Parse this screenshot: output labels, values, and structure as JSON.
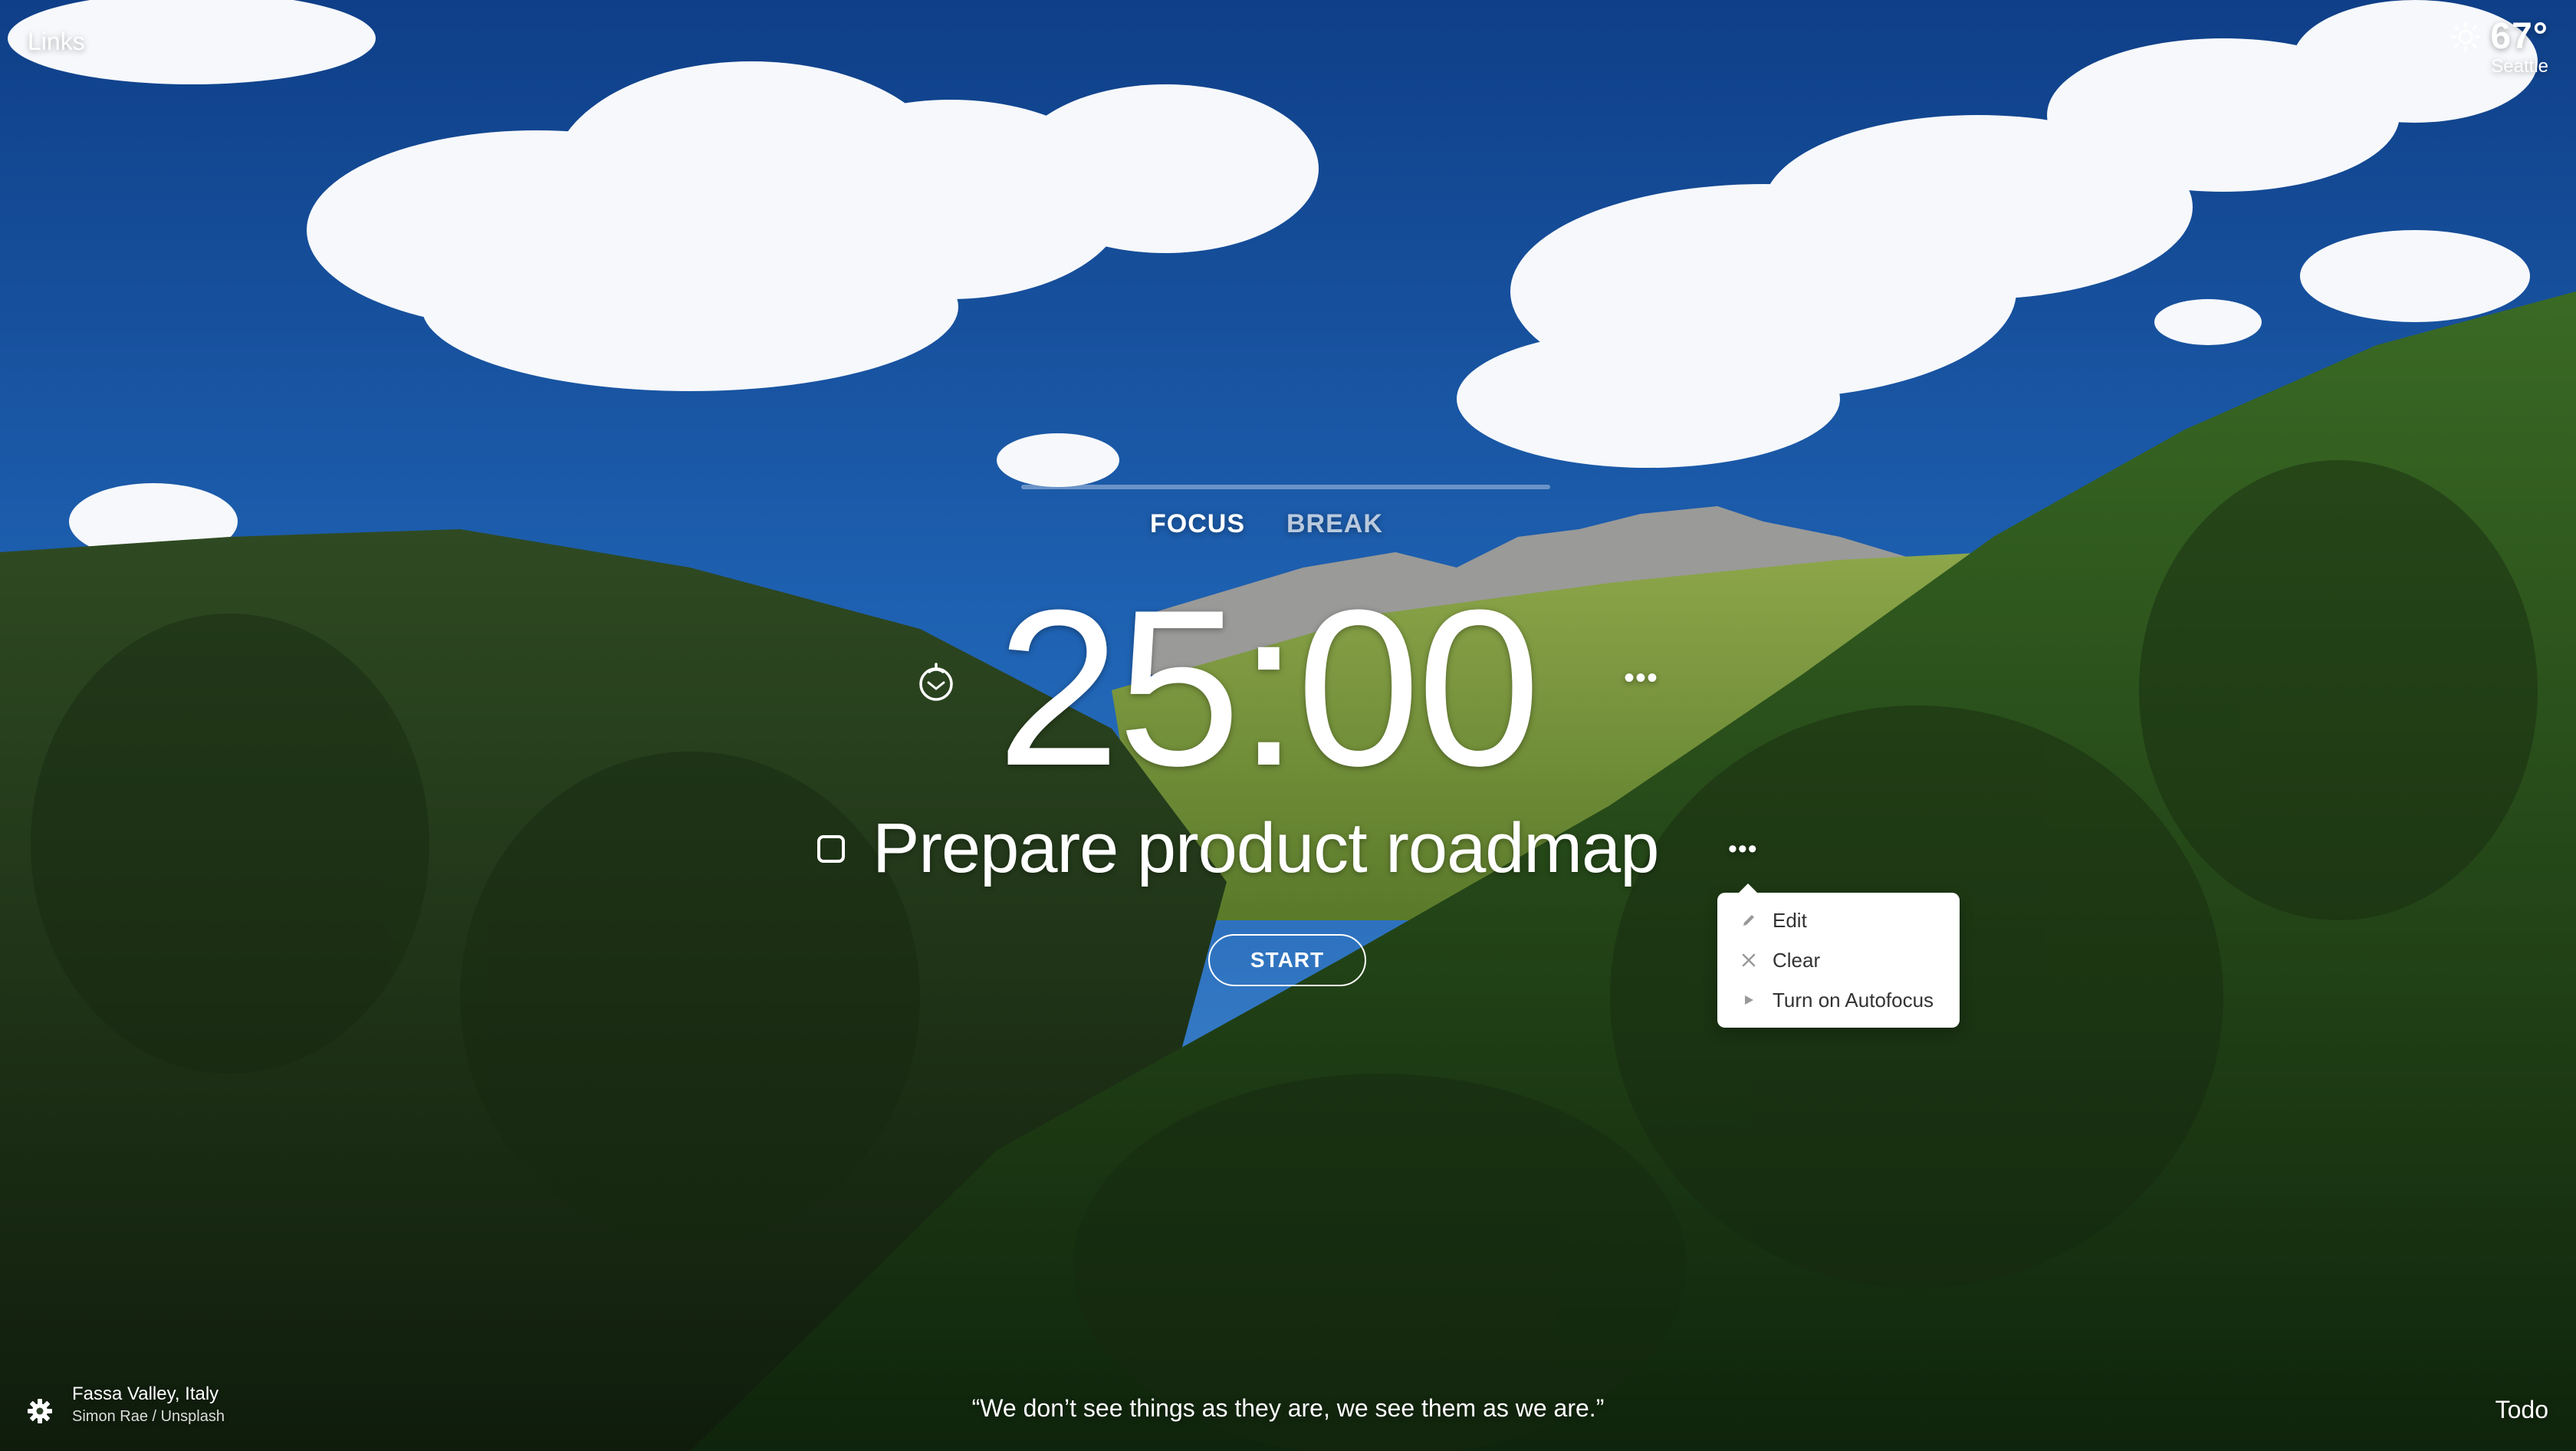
{
  "links_label": "Links",
  "weather": {
    "temperature": "67°",
    "location": "Seattle",
    "icon": "sun-icon"
  },
  "focus_progress": 0,
  "tabs": [
    {
      "label": "FOCUS"
    },
    {
      "label": "BREAK"
    }
  ],
  "timer": {
    "value": "25:00",
    "icon": "tomato-icon"
  },
  "focus": {
    "text": "Prepare product roadmap"
  },
  "start_label": "START",
  "menu": {
    "items": [
      {
        "label": "Edit",
        "icon": "pencil-icon"
      },
      {
        "label": "Clear",
        "icon": "close-icon"
      },
      {
        "label": "Turn on Autofocus",
        "icon": "play-icon"
      }
    ]
  },
  "photo": {
    "location": "Fassa Valley, Italy",
    "credit": "Simon Rae / Unsplash"
  },
  "quote": "“We don’t see things as they are, we see them as we are.”",
  "todo_label": "Todo",
  "colors": {
    "sky": "#1f5fa8",
    "forest": "#243d1a",
    "menu_bg": "#ffffff"
  }
}
